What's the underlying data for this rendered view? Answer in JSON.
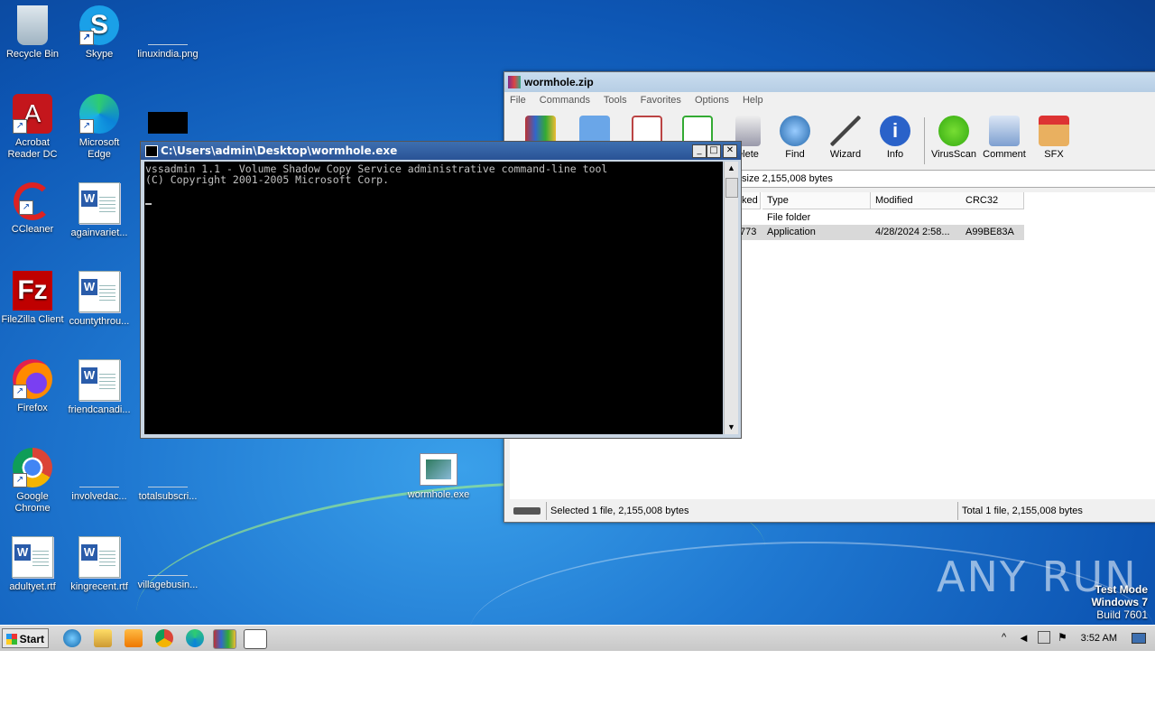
{
  "desktop": {
    "icons": [
      {
        "label": "Recycle Bin"
      },
      {
        "label": "Skype"
      },
      {
        "label": "linuxindia.png"
      },
      {
        "label": "Acrobat Reader DC"
      },
      {
        "label": "Microsoft Edge"
      },
      {
        "label": "CCleaner"
      },
      {
        "label": "againvariet..."
      },
      {
        "label": "FileZilla Client"
      },
      {
        "label": "countythrou..."
      },
      {
        "label": "Firefox"
      },
      {
        "label": "friendcanadi..."
      },
      {
        "label": "Google Chrome"
      },
      {
        "label": "involvedac..."
      },
      {
        "label": "totalsubscri..."
      },
      {
        "label": "wormhole.exe"
      },
      {
        "label": "adultyet.rtf"
      },
      {
        "label": "kingrecent.rtf"
      },
      {
        "label": "villagebusin..."
      }
    ]
  },
  "winrar": {
    "title": "wormhole.zip",
    "menu": [
      "File",
      "Commands",
      "Tools",
      "Favorites",
      "Options",
      "Help"
    ],
    "toolbar": [
      "elete",
      "Find",
      "Wizard",
      "Info",
      "VirusScan",
      "Comment",
      "SFX"
    ],
    "address": "size 2,155,008 bytes",
    "columns": [
      "ked",
      "Type",
      "Modified",
      "CRC32"
    ],
    "rows": [
      {
        "packed": "",
        "type": "File folder",
        "modified": "",
        "crc": ""
      },
      {
        "packed": "773",
        "type": "Application",
        "modified": "4/28/2024 2:58...",
        "crc": "A99BE83A"
      }
    ],
    "status_left": "Selected 1 file, 2,155,008 bytes",
    "status_right": "Total 1 file, 2,155,008 bytes"
  },
  "console": {
    "title": "C:\\Users\\admin\\Desktop\\wormhole.exe",
    "line1": "vssadmin 1.1 - Volume Shadow Copy Service administrative command-line tool",
    "line2": "(C) Copyright 2001-2005 Microsoft Corp."
  },
  "taskbar": {
    "start_label": "Start",
    "clock": "3:52 AM"
  },
  "watermark": {
    "line1": "Test Mode",
    "line2": "Windows 7",
    "line3": "Build 7601",
    "brand": "ANY RUN"
  }
}
